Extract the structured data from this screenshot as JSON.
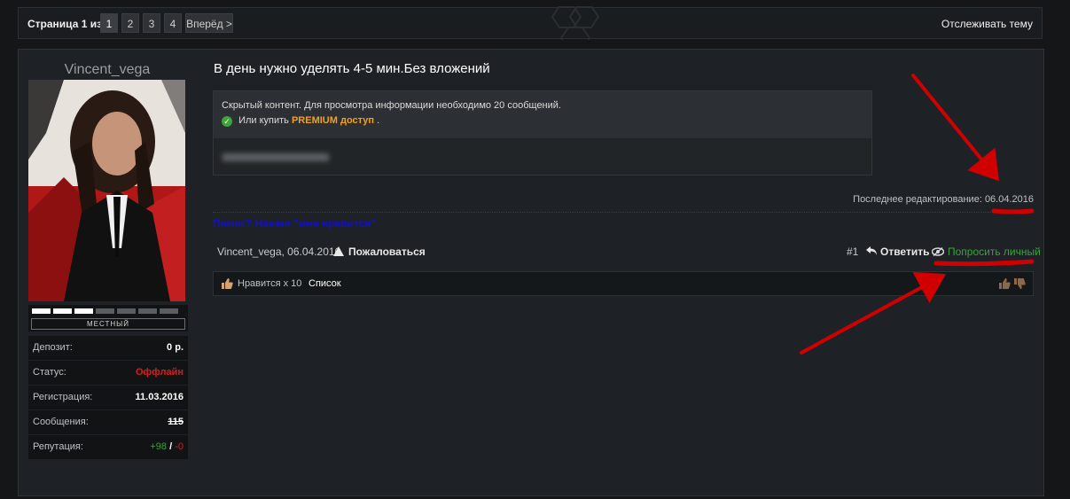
{
  "pagination": {
    "label": "Страница 1 из 4",
    "pages": [
      "1",
      "2",
      "3",
      "4"
    ],
    "current": "1",
    "next_label": "Вперёд >",
    "follow_label": "Отслеживать тему"
  },
  "user": {
    "name": "Vincent_vega",
    "rank": "МЕСТНЫЙ",
    "rank_level": 3,
    "rank_total": 7,
    "stats": {
      "deposit_label": "Депозит:",
      "deposit_value": "0 р.",
      "status_label": "Статус:",
      "status_value": "Оффлайн",
      "reg_label": "Регистрация:",
      "reg_value": "11.03.2016",
      "posts_label": "Сообщения:",
      "posts_value": "115",
      "rep_label": "Репутация:",
      "rep_plus": "+98",
      "rep_sep": "/",
      "rep_minus": "-0"
    }
  },
  "post": {
    "title": "В день нужно уделять 4-5 мин.Без вложений",
    "hidden_text": "Скрытый контент. Для просмотра информации необходимо 20 сообщений.",
    "buy_prefix": "Или купить",
    "buy_link": "PREMIUM доступ",
    "buy_suffix": ".",
    "edit_label": "Последнее редактирование:",
    "edit_date": "06.04.2016",
    "like_prompt": "Помог? Нажми \"мне нравится\"",
    "author_meta": "Vincent_vega, 06.04.2016",
    "report_label": "Пожаловаться",
    "post_number": "#1",
    "reply_label": "Ответить",
    "ask_label": "Попросить личный",
    "likes_text": "Нравится x 10",
    "likes_list": "Список"
  },
  "colors": {
    "background": "#141618",
    "panel": "#1e2226",
    "offline": "#d02020",
    "positive": "#3aa33a",
    "premium": "#f2a11c",
    "like_prompt": "#1010c8",
    "arrow": "#d00000"
  }
}
